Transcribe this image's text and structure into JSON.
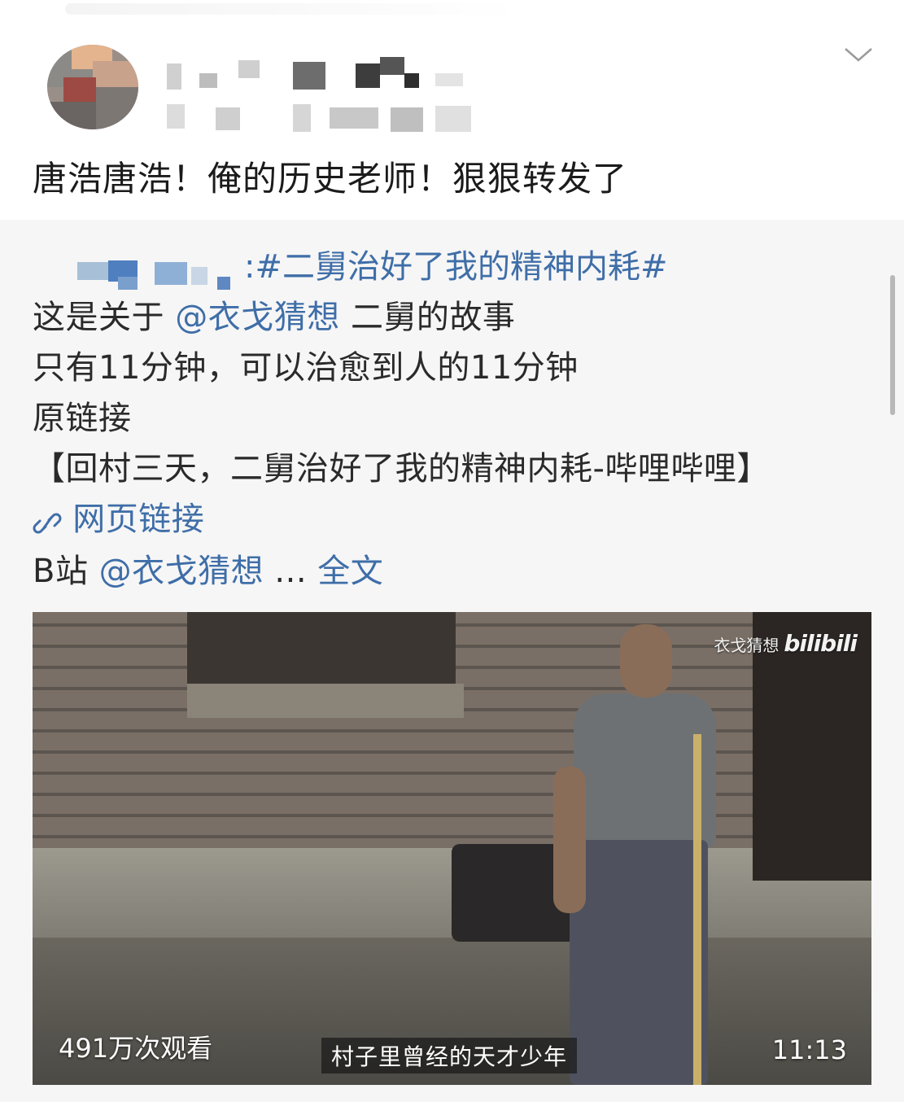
{
  "post": {
    "text": "唐浩唐浩！俺的历史老师！狠狠转发了"
  },
  "repost": {
    "topic": ":#二舅治好了我的精神内耗#",
    "line1_prefix": "这是关于",
    "line1_mention": "@衣戈猜想",
    "line1_suffix": "二舅的故事",
    "line2": "只有11分钟，可以治愈到人的11分钟",
    "line3": "原链接",
    "line4": "【回村三天，二舅治好了我的精神内耗-哔哩哔哩】",
    "link_label": "网页链接",
    "line6_prefix": "B站",
    "line6_mention": "@衣戈猜想",
    "line6_ellipsis": "...",
    "more_label": "全文"
  },
  "video": {
    "watermark_text": "衣戈猜想",
    "watermark_brand": "bilibili",
    "views": "491万次观看",
    "duration": "11:13",
    "subtitle": "村子里曾经的天才少年"
  },
  "colors": {
    "link": "#3f6ea8",
    "repost_bg": "#f6f6f6",
    "text": "#1b1b1b"
  },
  "icons": {
    "chevron": "chevron-down-icon",
    "link": "link-icon"
  }
}
